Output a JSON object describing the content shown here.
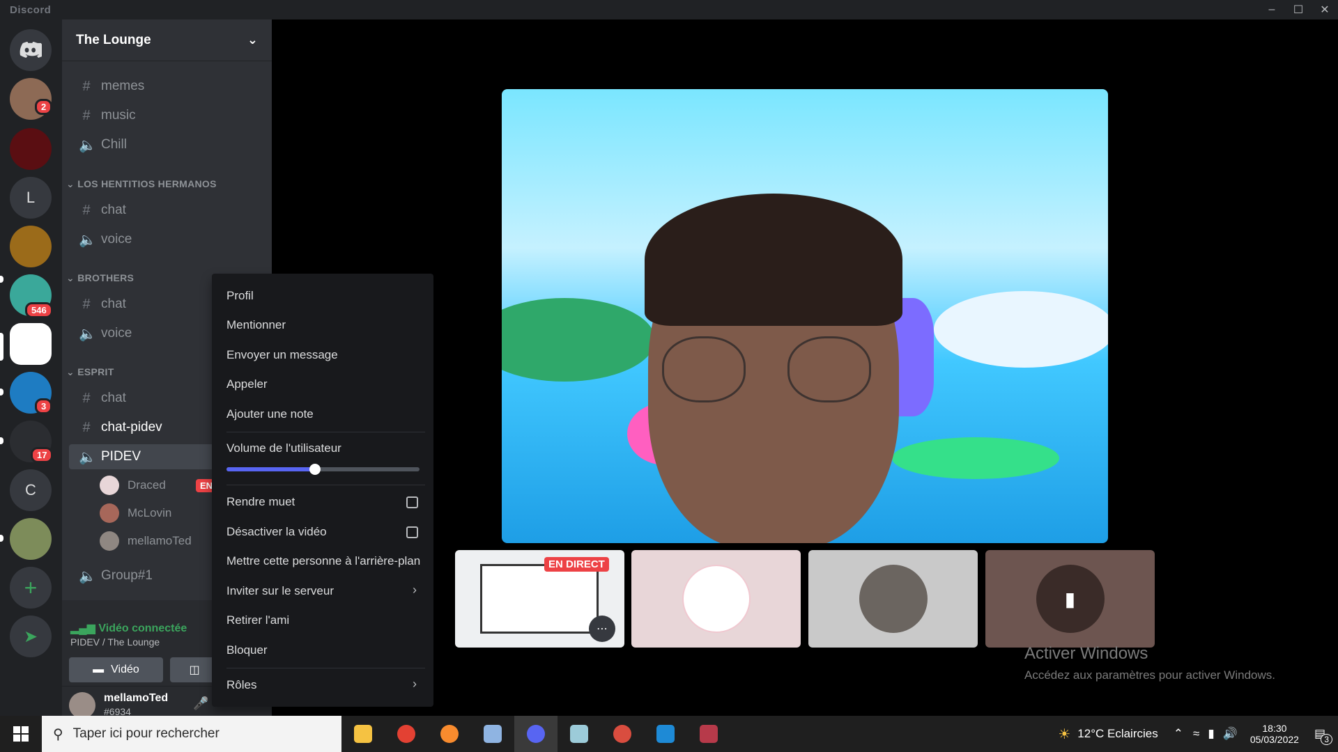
{
  "app": {
    "title": "Discord"
  },
  "rail": {
    "servers": [
      {
        "kind": "home",
        "label": ""
      },
      {
        "kind": "avatar",
        "badge": "2"
      },
      {
        "kind": "avatar",
        "badge": ""
      },
      {
        "kind": "letter",
        "label": "L"
      },
      {
        "kind": "avatar",
        "badge": ""
      },
      {
        "kind": "avatar",
        "badge": "546"
      },
      {
        "kind": "avatar",
        "badge": ""
      },
      {
        "kind": "avatar",
        "badge": "3"
      },
      {
        "kind": "avatar",
        "badge": "17"
      },
      {
        "kind": "letter",
        "label": "C"
      },
      {
        "kind": "avatar",
        "badge": ""
      }
    ],
    "badges": {
      "b1": "2",
      "b2": "546",
      "b3": "3",
      "b4": "17"
    },
    "letters": {
      "l1": "L",
      "l2": "C"
    }
  },
  "sidebar": {
    "server_name": "The Lounge",
    "channels": {
      "memes": "memes",
      "music": "music",
      "chill": "Chill",
      "cat1": "LOS HENTITIOS HERMANOS",
      "cat1_chat": "chat",
      "cat1_voice": "voice",
      "cat2": "BROTHERS",
      "cat2_chat": "chat",
      "cat2_voice": "voice",
      "cat3": "ESPRIT",
      "cat3_chat": "chat",
      "cat3_chatpidev": "chat-pidev",
      "cat3_pidev": "PIDEV",
      "group": "Group#1"
    },
    "voice_users": [
      {
        "name": "Draced",
        "live": "EN"
      },
      {
        "name": "McLovin"
      },
      {
        "name": "mellamoTed"
      }
    ],
    "voice_panel": {
      "status": "Vidéo connectée",
      "location": "PIDEV / The Lounge",
      "video_button": "Vidéo"
    },
    "user": {
      "name": "mellamoTed",
      "tag": "#6934"
    }
  },
  "context_menu": {
    "profile": "Profil",
    "mention": "Mentionner",
    "message": "Envoyer un message",
    "call": "Appeler",
    "note": "Ajouter une note",
    "volume_label": "Volume de l'utilisateur",
    "volume_level": 0.46,
    "mute": "Rendre muet",
    "disable_video": "Désactiver la vidéo",
    "background": "Mettre cette personne à l'arrière-plan",
    "invite": "Inviter sur le serveur",
    "remove_friend": "Retirer l'ami",
    "block": "Bloquer",
    "roles": "Rôles"
  },
  "stage": {
    "live_badge": "EN DIRECT",
    "activate_title": "Activer Windows",
    "activate_sub": "Accédez aux paramètres pour activer Windows."
  },
  "taskbar": {
    "search_placeholder": "Taper ici pour rechercher",
    "weather": "12°C Eclaircies",
    "time": "18:30",
    "date": "05/03/2022",
    "notif_count": "3"
  },
  "colors": {
    "accent": "#5865f2",
    "green": "#3ba55d",
    "red": "#ed4245"
  }
}
